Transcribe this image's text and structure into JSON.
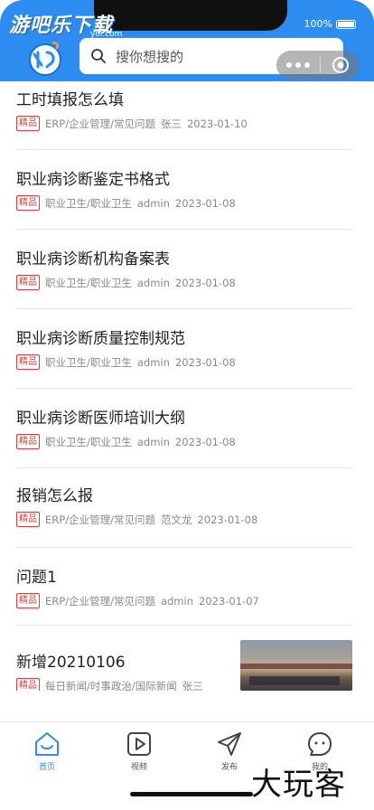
{
  "status": {
    "battery": "100%"
  },
  "watermark": {
    "text": "游吧乐下载",
    "url": "yol.com"
  },
  "search": {
    "placeholder": "搜你想搜的"
  },
  "list": [
    {
      "title": "工时填报怎么填",
      "badge": "精品",
      "category": "ERP/企业管理/常见问题",
      "author": "张三",
      "date": "2023-01-10"
    },
    {
      "title": "职业病诊断鉴定书格式",
      "badge": "精品",
      "category": "职业卫生/职业卫生",
      "author": "admin",
      "date": "2023-01-08"
    },
    {
      "title": "职业病诊断机构备案表",
      "badge": "精品",
      "category": "职业卫生/职业卫生",
      "author": "admin",
      "date": "2023-01-08"
    },
    {
      "title": "职业病诊断质量控制规范",
      "badge": "精品",
      "category": "职业卫生/职业卫生",
      "author": "admin",
      "date": "2023-01-08"
    },
    {
      "title": "职业病诊断医师培训大纲",
      "badge": "精品",
      "category": "职业卫生/职业卫生",
      "author": "admin",
      "date": "2023-01-08"
    },
    {
      "title": "报销怎么报",
      "badge": "精品",
      "category": "ERP/企业管理/常见问题",
      "author": "范文龙",
      "date": "2023-01-08"
    },
    {
      "title": "问题1",
      "badge": "精品",
      "category": "ERP/企业管理/常见问题",
      "author": "admin",
      "date": "2023-01-07"
    },
    {
      "title": "新增20210106",
      "badge": "精品",
      "category": "每日新闻/时事政治/国际新闻",
      "author": "张三",
      "date": ""
    }
  ],
  "tabbar": {
    "home": "首页",
    "video": "视频",
    "publish": "发布",
    "mine": "我的"
  },
  "corner_watermark": "大玩客",
  "colors": {
    "accent": "#2d8cf0",
    "badge": "#e23a3a"
  }
}
